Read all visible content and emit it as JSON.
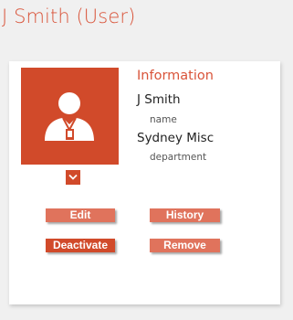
{
  "page": {
    "title": "J Smith (User)"
  },
  "card": {
    "heading": "Information",
    "name_value": "J Smith",
    "name_label": "name",
    "department_value": "Sydney Misc",
    "department_label": "department"
  },
  "avatar": {
    "icon": "user-icon",
    "expand_icon": "chevron-down-icon"
  },
  "actions": {
    "edit": "Edit",
    "history": "History",
    "deactivate": "Deactivate",
    "remove": "Remove"
  },
  "colors": {
    "accent": "#d14a2a",
    "accent_light": "#e0735c",
    "title": "#d9543a",
    "background": "#f0f0f0",
    "card": "#ffffff"
  }
}
